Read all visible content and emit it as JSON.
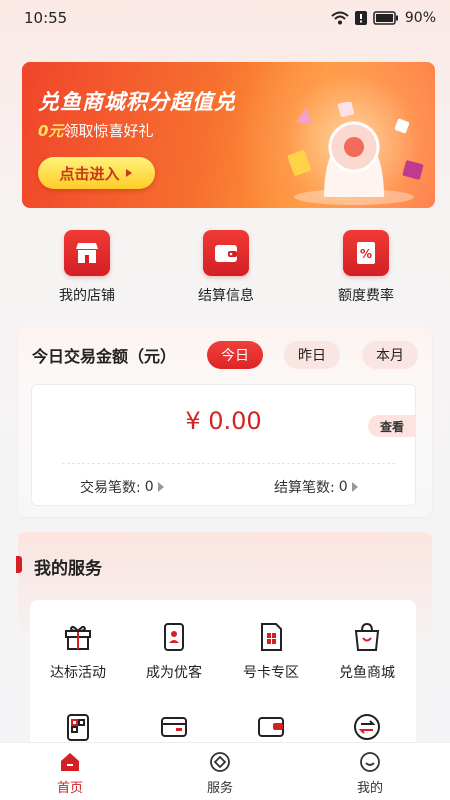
{
  "status_bar": {
    "time": "10:55",
    "battery": "90%",
    "icons": [
      "wifi-icon",
      "alert-icon",
      "battery-icon"
    ]
  },
  "banner": {
    "title": "兑鱼商城积分超值兑",
    "subtitle_highlight": "0元",
    "subtitle_rest": "领取惊喜好礼",
    "button_label": "点击进入",
    "dots_count": 4,
    "active_dot": 1
  },
  "quick_actions": [
    {
      "label": "我的店铺",
      "icon": "store-icon"
    },
    {
      "label": "结算信息",
      "icon": "wallet-icon"
    },
    {
      "label": "额度费率",
      "icon": "rate-icon"
    }
  ],
  "transaction": {
    "title": "今日交易金额（元）",
    "tabs": [
      "今日",
      "昨日",
      "本月"
    ],
    "active_tab": "今日",
    "amount": "¥ 0.00",
    "view_label": "查看",
    "trade_count_label": "交易笔数:",
    "trade_count_value": "0",
    "settle_count_label": "结算笔数:",
    "settle_count_value": "0"
  },
  "services": {
    "title": "我的服务",
    "items": [
      {
        "label": "达标活动",
        "icon": "gift-icon"
      },
      {
        "label": "成为优客",
        "icon": "user-card-icon"
      },
      {
        "label": "号卡专区",
        "icon": "sim-card-icon"
      },
      {
        "label": "兑鱼商城",
        "icon": "shopping-bag-icon"
      },
      {
        "label": "",
        "icon": "qr-code-icon"
      },
      {
        "label": "",
        "icon": "card-icon"
      },
      {
        "label": "",
        "icon": "wallet-icon"
      },
      {
        "label": "",
        "icon": "exchange-icon"
      }
    ]
  },
  "bottom_nav": [
    {
      "label": "首页",
      "icon": "home-icon",
      "active": true
    },
    {
      "label": "服务",
      "icon": "service-icon",
      "active": false
    },
    {
      "label": "我的",
      "icon": "profile-icon",
      "active": false
    }
  ],
  "colors": {
    "brand_red": "#d42025",
    "banner_orange": "#f7702f",
    "button_yellow": "#ffcc27"
  }
}
